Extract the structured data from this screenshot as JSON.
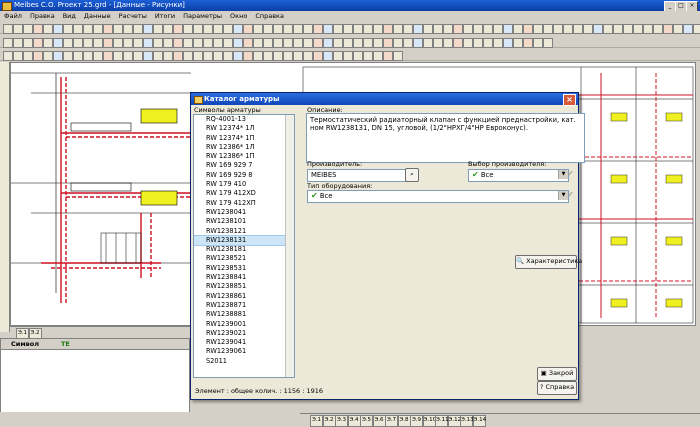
{
  "window": {
    "title": "Meibes C.O.   Prоект 25.grd - [Данные - Рисунки]"
  },
  "menu": [
    "Файл",
    "Правка",
    "Вид",
    "Данные",
    "Расчеты",
    "Итоги",
    "Параметры",
    "Окно",
    "Справка"
  ],
  "left_panel": {
    "tabs": [
      "Символ",
      "ТЕ"
    ]
  },
  "bottom_tabs": [
    "Э.1",
    "Э.2",
    "Э.3",
    "Э.4",
    "Э.5",
    "Э.6",
    "Э.7",
    "Э.8",
    "Э.9",
    "Э.10",
    "Э.11",
    "Э.12",
    "Э.13",
    "Э.14"
  ],
  "dialog": {
    "title": "Каталог арматуры",
    "list_label": "Символы арматуры",
    "items": [
      "RQ-4001-13",
      "RW 12374* 1Л",
      "RW 12374* 1П",
      "RW 12386* 1Л",
      "RW 12386* 1П",
      "RW 169 929 7",
      "RW 169 929 8",
      "RW 179 410",
      "RW 179 412XD",
      "RW 179 412ХП",
      "RW1238041",
      "RW1238101",
      "RW1238121",
      "RW1238131",
      "RW1238181",
      "RW1238521",
      "RW1238531",
      "RW1238841",
      "RW1238851",
      "RW1238861",
      "RW1238871",
      "RW1238881",
      "RW1239001",
      "RW1239021",
      "RW1239041",
      "RW1239061",
      "S2011"
    ],
    "selected_index": 13,
    "description_label": "Описание:",
    "description": "Термостатический радиаторный клапан с функцией преднастройки, кат. ном RW1238131, DN 15, угловой, (1/2\"НРХГ/4\"НР Евроконус).",
    "manufacturer_label": "Производитель:",
    "manufacturer_value": "MEIBES",
    "manufacturer_select_label": "Выбор производителя:",
    "manufacturer_select_value": "Все",
    "equipment_type_label": "Тип оборудования:",
    "equipment_type_value": "Все",
    "characteristics_button": "Характеристика",
    "close_button": "Закрой",
    "help_button": "Справка",
    "status": "Элемент : общее колич. : 1156 : 1916"
  },
  "colors": {
    "accent": "#0a246a",
    "check": "#2a9a20",
    "drawing_red": "#d01020",
    "drawing_yellow": "#f0f020"
  }
}
